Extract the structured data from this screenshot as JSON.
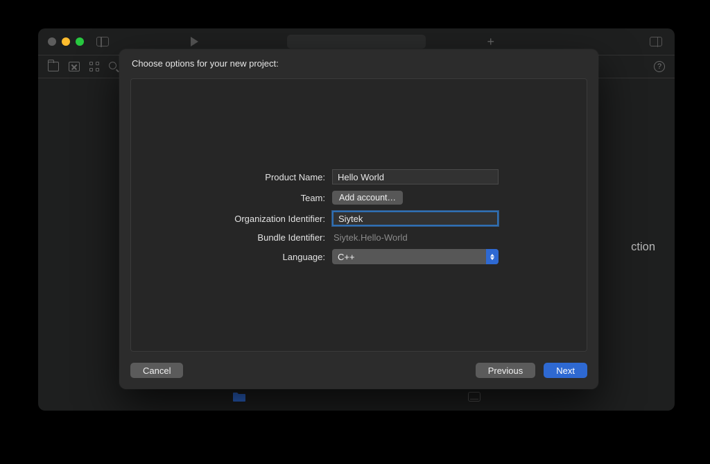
{
  "sheet": {
    "title": "Choose options for your new project:",
    "fields": {
      "product_name_label": "Product Name:",
      "product_name_value": "Hello World",
      "team_label": "Team:",
      "add_account_label": "Add account…",
      "org_id_label": "Organization Identifier:",
      "org_id_value": "Siytek",
      "bundle_id_label": "Bundle Identifier:",
      "bundle_id_value": "Siytek.Hello-World",
      "language_label": "Language:",
      "language_value": "C++"
    },
    "buttons": {
      "cancel": "Cancel",
      "previous": "Previous",
      "next": "Next"
    }
  },
  "background": {
    "partial_text": "ction",
    "help_glyph": "?",
    "plus_glyph": "+"
  }
}
